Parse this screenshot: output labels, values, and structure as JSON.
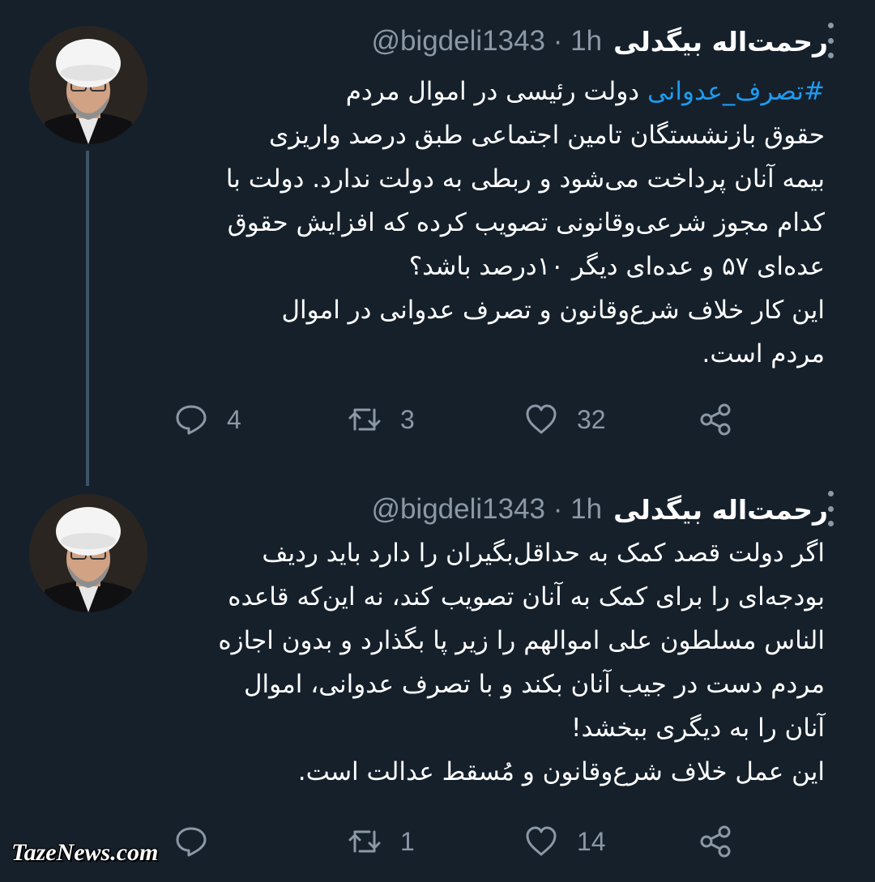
{
  "tweets": [
    {
      "name": "رحمت‌اله بیگدلی",
      "handle": "@bigdeli1343 · 1h",
      "hashtag": "#تصرف_عدوانی",
      "first_line_rest": " دولت رئیسی در اموال مردم",
      "lines": [
        "حقوق بازنشستگان تامین اجتماعی طبق درصد واریزی",
        "بیمه آنان پرداخت می‌شود و ربطی به دولت ندارد. دولت با",
        "کدام مجوز شرعی‌وقانونی تصویب کرده که افزایش حقوق",
        "عده‌ای ۵۷ و عده‌ای دیگر ۱۰درصد باشد؟",
        "این کار خلاف شرع‌وقانون و تصرف عدوانی در اموال",
        "مردم است."
      ],
      "replies": "4",
      "retweets": "3",
      "likes": "32"
    },
    {
      "name": "رحمت‌اله بیگدلی",
      "handle": "@bigdeli1343 · 1h",
      "lines": [
        "اگر دولت قصد کمک به حداقل‌بگیران را دارد باید ردیف",
        "بودجه‌ای را برای کمک به آنان تصویب کند، نه این‌که قاعده",
        "الناس مسلطون علی اموالهم را زیر پا بگذارد و بدون اجازه",
        "مردم دست در جیب آنان بکند و با تصرف عدوانی، اموال",
        "آنان را به دیگری ببخشد!",
        "این عمل خلاف شرع‌وقانون و مُسقط عدالت است."
      ],
      "replies": "",
      "retweets": "1",
      "likes": "14"
    }
  ],
  "watermark": "TazeNews.com",
  "colors": {
    "background": "#15202b",
    "text": "#ffffff",
    "secondary": "#8b98a5",
    "link": "#1d9bf0"
  }
}
